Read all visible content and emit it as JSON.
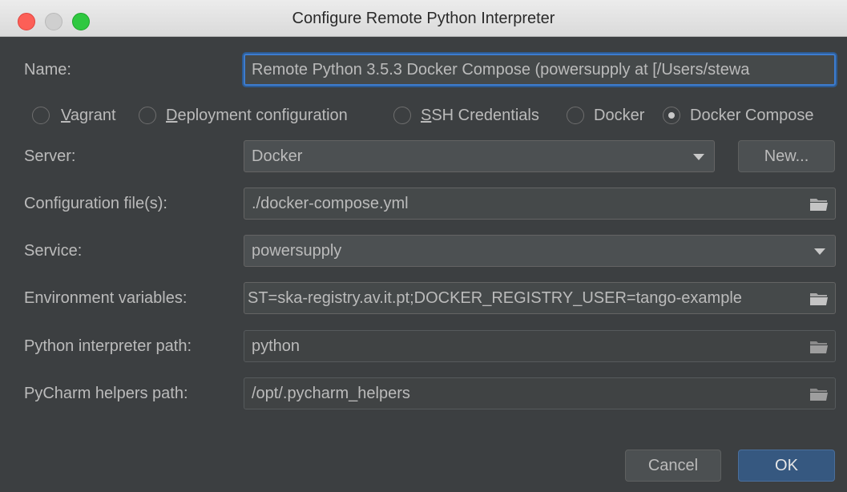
{
  "window": {
    "title": "Configure Remote Python Interpreter"
  },
  "form": {
    "name_label": "Name:",
    "name_value": "Remote Python 3.5.3 Docker Compose (powersupply at [/Users/stewa",
    "radio_options": [
      {
        "prefix": "",
        "mnemonic": "V",
        "rest": "agrant",
        "selected": false
      },
      {
        "prefix": "",
        "mnemonic": "D",
        "rest": "eployment configuration",
        "selected": false
      },
      {
        "prefix": "",
        "mnemonic": "S",
        "rest": "SH Credentials",
        "selected": false
      },
      {
        "prefix": "Docker",
        "mnemonic": "",
        "rest": "",
        "selected": false
      },
      {
        "prefix": "Docker Compose",
        "mnemonic": "",
        "rest": "",
        "selected": true
      }
    ],
    "server_label": "Server:",
    "server_value": "Docker",
    "new_button": "New...",
    "config_label": "Configuration file(s):",
    "config_value": "./docker-compose.yml",
    "service_label": "Service:",
    "service_value": "powersupply",
    "env_label": "Environment variables:",
    "env_value": "ST=ska-registry.av.it.pt;DOCKER_REGISTRY_USER=tango-example",
    "python_label": "Python interpreter path:",
    "python_value": "python",
    "helpers_label": "PyCharm helpers path:",
    "helpers_value": "/opt/.pycharm_helpers"
  },
  "buttons": {
    "cancel": "Cancel",
    "ok": "OK"
  },
  "colors": {
    "background": "#3c3f41",
    "accent": "#3d7ccf",
    "ok_button": "#365880"
  },
  "icons": [
    "folder-icon",
    "chevron-down-icon"
  ]
}
